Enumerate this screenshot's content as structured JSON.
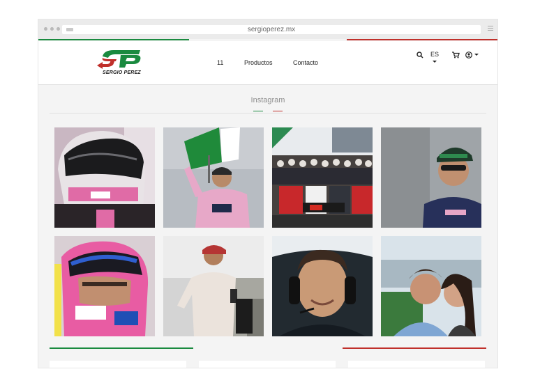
{
  "browser": {
    "url": "sergioperez.mx"
  },
  "brand": {
    "name": "SERGIO PEREZ",
    "green": "#1a8a3f",
    "red": "#c0302b"
  },
  "nav": {
    "items": [
      "11",
      "Productos",
      "Contacto"
    ]
  },
  "utilities": {
    "language": "ES",
    "icons": [
      "search-icon",
      "cart-icon",
      "user-icon"
    ]
  },
  "section": {
    "title": "Instagram"
  },
  "photos": [
    {
      "name": "photo-helmet-pink"
    },
    {
      "name": "photo-podium-flag"
    },
    {
      "name": "photo-team-group"
    },
    {
      "name": "photo-cap-portrait"
    },
    {
      "name": "photo-helmet-closeup"
    },
    {
      "name": "photo-pitlane"
    },
    {
      "name": "photo-selfie-cockpit"
    },
    {
      "name": "photo-couple-beach"
    }
  ]
}
